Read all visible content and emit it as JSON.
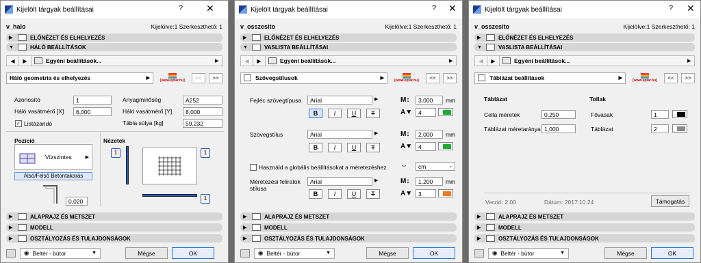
{
  "window_title": "Kijelölt tárgyak beállításai",
  "title_help": "?",
  "title_close": "✕",
  "selection_info": "Kijelölve:1 Szerkeszthető: 1",
  "selection_info_1": "Kijelölve:1 Szerkeszthető: 1",
  "arrow_left": "◀",
  "arrow_right": "▶",
  "arrow_down": "▼",
  "collapsed_arrow": "▶",
  "expanded_arrow": "▼",
  "logo_text": "[www.eptar.hu]",
  "btn_prev": "<<",
  "btn_next": ">>",
  "unit_mm": "mm",
  "swatch_glyph": "I",
  "custom_settings": "Egyéni beállítások...",
  "footer": {
    "layer": "Beltér - bútor",
    "cancel": "Mégse",
    "ok": "OK"
  },
  "panel1": {
    "element_name": "v_halo",
    "sections_top": [
      "ELŐNÉZET ÉS ELHELYEZÉS",
      "HÁLÓ BEÁLLÍTÁSOK"
    ],
    "page_label": "Háló geometria és elhelyezés",
    "fields": {
      "azonosito_label": "Azonosító",
      "azonosito_value": "1",
      "halo_x_label": "Háló vasátmérő [X]",
      "halo_x_value": "6,000",
      "listazando_label": "Listázandó",
      "listazando_check": "✓",
      "anyag_label": "Anyagminőség",
      "anyag_value": "A252",
      "halo_y_label": "Háló vasátmérő [Y]",
      "halo_y_value": "8,000",
      "tabla_label": "Tábla súlya [kg]",
      "tabla_value": "59,232"
    },
    "pozicio_label": "Pozíció",
    "pozicio_value": "Vízszintes",
    "betonkatas": "Alsó/Felső Betontakarás",
    "cover_value": "0,020",
    "nezetek_label": "Nézetek",
    "view_marker": "1",
    "sections_bottom": [
      "ALAPRAJZ ÉS METSZET",
      "MODELL",
      "OSZTÁLYOZÁS ÉS TULAJDONSÁGOK"
    ]
  },
  "panel2": {
    "element_name": "v_osszesito",
    "sections_top": [
      "ELŐNÉZET ÉS ELHELYEZÉS",
      "VASLISTA BEÁLLÍTÁSAI"
    ],
    "page_label": "Szövegstílusok",
    "fejlec_label": "Fejléc szövegtípusa",
    "fejlec_font": "Arial",
    "fejlec_size": "3,000",
    "fejlec_pen": "4",
    "szoveg_label": "Szövegstílus",
    "szoveg_font": "Arial",
    "szoveg_size": "2,000",
    "szoveg_pen": "4",
    "global_label": "Használd a globális beállításokat a méretezéshez",
    "unit_value": "cm",
    "meret_label_1": "Méretezési feliratok",
    "meret_label_2": "stílusa",
    "meret_font": "Arial",
    "meret_size": "1,200",
    "meret_pen": "3",
    "style_b": "B",
    "style_i": "I",
    "style_u": "U",
    "style_t": "T",
    "icon_m": "M↕",
    "icon_a": "A▼",
    "swatch_colors": [
      "#1faa3a",
      "#1faa3a",
      "#f07820"
    ],
    "sections_bottom": [
      "ALAPRAJZ ÉS METSZET",
      "MODELL",
      "OSZTÁLYOZÁS ÉS TULAJDONSÁGOK"
    ]
  },
  "panel3": {
    "element_name": "v_osszesito",
    "sections_top": [
      "ELŐNÉZET ÉS ELHELYEZÉS",
      "VASLISTA BEÁLLÍTÁSAI"
    ],
    "page_label": "Táblázat beállítások",
    "tablazat_head": "Táblázat",
    "tollak_head": "Tollak",
    "cella_label": "Cella méretek",
    "cella_value": "0,250",
    "arany_label": "Táblázat méretaránya",
    "arany_value": "1,000",
    "fovasak_label": "Fővasak",
    "fovasak_value": "1",
    "tablazat_label": "Táblázat",
    "tablazat_value": "2",
    "pen_colors": [
      "#000000",
      "#8a8a8a"
    ],
    "version": "Verzió: 2.00",
    "date": "Dátum: 2017.10.24",
    "support": "Támogatás",
    "sections_bottom": [
      "ALAPRAJZ ÉS METSZET",
      "MODELL",
      "OSZTÁLYOZÁS ÉS TULAJDONSÁGOK"
    ]
  }
}
